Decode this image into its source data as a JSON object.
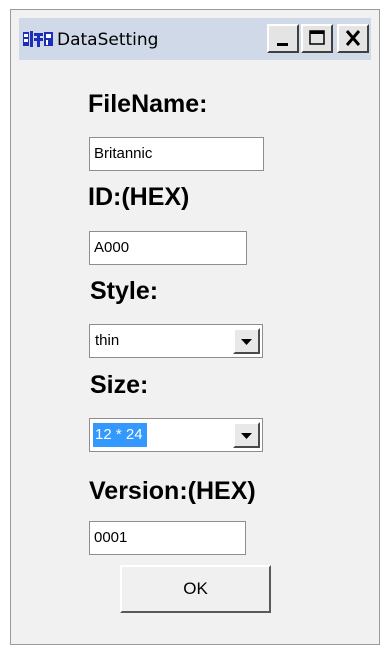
{
  "window": {
    "title": "DataSetting",
    "title_bar_color": "#cfd9e8",
    "buttons": {
      "minimize_icon": "minimize-icon",
      "maximize_icon": "maximize-icon",
      "close_icon": "close-icon"
    }
  },
  "form": {
    "filename_label": "FileName:",
    "filename_value": "Britannic",
    "id_label": "ID:(HEX)",
    "id_value": "A000",
    "style_label": "Style:",
    "style_value": "thin",
    "size_label": "Size:",
    "size_value": "12 * 24",
    "version_label": "Version:(HEX)",
    "version_value": "0001",
    "ok_label": "OK"
  },
  "colors": {
    "selection": "#3399ff"
  }
}
